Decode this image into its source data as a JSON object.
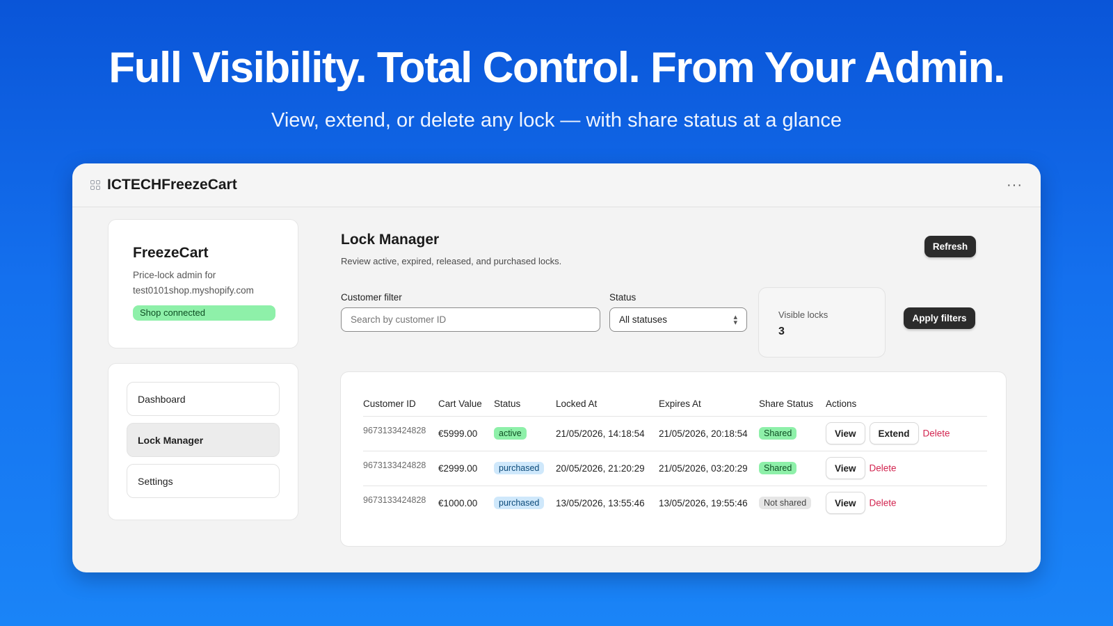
{
  "hero": {
    "title": "Full Visibility. Total Control. From Your Admin.",
    "subtitle": "View, extend, or delete any lock — with share status at a glance"
  },
  "window": {
    "app_title": "ICTECHFreezeCart",
    "more_label": "···"
  },
  "shop": {
    "name": "FreezeCart",
    "desc_line1": "Price-lock admin for",
    "desc_line2": "test0101shop.myshopify.com",
    "badge": "Shop connected"
  },
  "nav": {
    "items": [
      {
        "label": "Dashboard"
      },
      {
        "label": "Lock Manager"
      },
      {
        "label": "Settings"
      }
    ]
  },
  "main": {
    "title": "Lock Manager",
    "description": "Review active, expired, released, and purchased locks.",
    "refresh_label": "Refresh",
    "apply_label": "Apply filters"
  },
  "filters": {
    "customer_label": "Customer filter",
    "customer_placeholder": "Search by customer ID",
    "status_label": "Status",
    "status_value": "All statuses",
    "visible_label": "Visible locks",
    "visible_value": "3"
  },
  "table": {
    "headers": [
      "Customer ID",
      "Cart Value",
      "Status",
      "Locked At",
      "Expires At",
      "Share Status",
      "Actions"
    ],
    "rows": [
      {
        "customer_id": "9673133424828",
        "cart_value": "€5999.00",
        "status": "active",
        "locked_at": "21/05/2026, 14:18:54",
        "expires_at": "21/05/2026, 20:18:54",
        "share_status": "Shared",
        "view": "View",
        "extend": "Extend",
        "delete": "Delete"
      },
      {
        "customer_id": "9673133424828",
        "cart_value": "€2999.00",
        "status": "purchased",
        "locked_at": "20/05/2026, 21:20:29",
        "expires_at": "21/05/2026, 03:20:29",
        "share_status": "Shared",
        "view": "View",
        "delete": "Delete"
      },
      {
        "customer_id": "9673133424828",
        "cart_value": "€1000.00",
        "status": "purchased",
        "locked_at": "13/05/2026, 13:55:46",
        "expires_at": "13/05/2026, 19:55:46",
        "share_status": "Not shared",
        "view": "View",
        "delete": "Delete"
      }
    ]
  },
  "colors": {
    "background_top": "#0a55d8",
    "background_bottom": "#1a84f7",
    "badge_green": "#8ef0a9",
    "badge_blue": "#cfe8fb",
    "delete_red": "#d2244f",
    "button_dark": "#2b2b2b"
  },
  "icons": {
    "app": "app-grid-icon",
    "more": "more-horizontal-icon",
    "select": "chevron-up-down-icon"
  }
}
